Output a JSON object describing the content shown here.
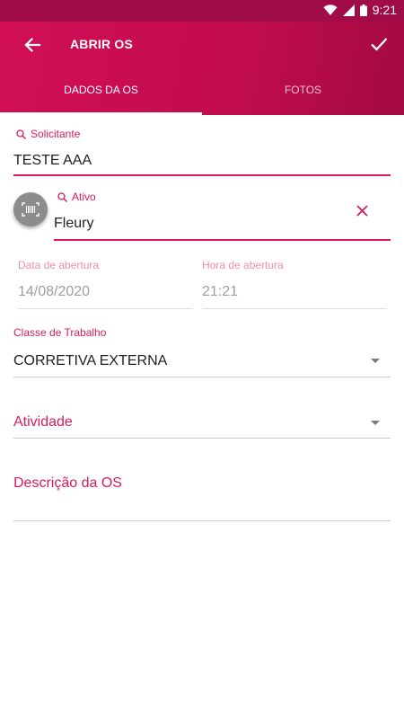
{
  "status_bar": {
    "time": "9:21",
    "icons": [
      "wifi-icon",
      "signal-icon",
      "battery-icon"
    ]
  },
  "app_bar": {
    "title": "ABRIR OS",
    "back_icon": "arrow-left-icon",
    "confirm_icon": "check-icon",
    "tabs": [
      {
        "label": "DADOS DA OS",
        "active": true
      },
      {
        "label": "FOTOS",
        "active": false
      }
    ]
  },
  "form": {
    "solicitante": {
      "label": "Solicitante",
      "value": "TESTE AAA",
      "icon": "search-icon"
    },
    "ativo": {
      "label": "Ativo",
      "value": "Fleury",
      "icon": "search-icon",
      "scan_icon": "barcode-icon",
      "clear_icon": "close-icon"
    },
    "data_abertura": {
      "label": "Data de abertura",
      "value": "14/08/2020"
    },
    "hora_abertura": {
      "label": "Hora de abertura",
      "value": "21:21"
    },
    "classe_trabalho": {
      "label": "Classe de Trabalho",
      "value": "CORRETIVA EXTERNA"
    },
    "atividade": {
      "label": "Atividade"
    },
    "descricao": {
      "label": "Descrição da OS"
    }
  },
  "colors": {
    "primary": "#d81b60",
    "primary_dark": "#a00c47",
    "muted_label": "#f08db1",
    "text": "#212121",
    "muted_text": "#9e9e9e"
  }
}
